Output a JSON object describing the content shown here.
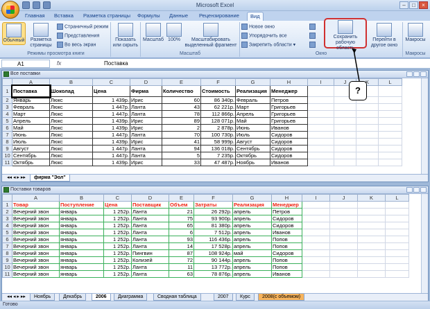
{
  "app_title": "Microsoft Excel",
  "tabs": [
    "Главная",
    "Вставка",
    "Разметка страницы",
    "Формулы",
    "Данные",
    "Рецензирование",
    "Вид"
  ],
  "active_tab": "Вид",
  "ribbon": {
    "normal": "Обычный",
    "page_layout": "Разметка страницы",
    "page_mode": "Страничный режим",
    "views": "Представления",
    "fullscreen": "Во весь экран",
    "group_views": "Режимы просмотра книги",
    "show_hide": "Показать или скрыть",
    "zoom": "Масштаб",
    "zoom100": "100%",
    "zoom_sel": "Масштабировать выделенный фрагмент",
    "group_zoom": "Масштаб",
    "new_window": "Новое окно",
    "arrange_all": "Упорядочить все",
    "freeze": "Закрепить области",
    "save_ws": "Сохранить рабочую область",
    "switch": "Перейти в другое окно",
    "group_window": "Окно",
    "macros": "Макросы",
    "group_macros": "Макросы"
  },
  "formula": {
    "cell": "A1",
    "fx": "fx",
    "value": "Поставка"
  },
  "callout": "?",
  "cols": [
    "A",
    "B",
    "C",
    "D",
    "E",
    "F",
    "G",
    "H",
    "I",
    "J",
    "K",
    "L"
  ],
  "win1": {
    "title": "Все поставки",
    "headers": [
      "Поставка",
      "Шоколад",
      "Цена",
      "Фирма",
      "Количество",
      "Стоимость",
      "Реализация",
      "Менеджер"
    ],
    "rows": [
      [
        "2",
        "Январь",
        "Люкс",
        "1 439р.",
        "Ирис",
        "60",
        "86 340р.",
        "Февраль",
        "Петров"
      ],
      [
        "3",
        "Февраль",
        "Люкс",
        "1 447р.",
        "Ланта",
        "43",
        "62 221р.",
        "Март",
        "Григорьев"
      ],
      [
        "4",
        "Март",
        "Люкс",
        "1 447р.",
        "Ланта",
        "78",
        "112 866р.",
        "Апрель",
        "Григорьев"
      ],
      [
        "5",
        "Апрель",
        "Люкс",
        "1 439р.",
        "Ирис",
        "89",
        "128 071р.",
        "Май",
        "Григорьев"
      ],
      [
        "6",
        "Май",
        "Люкс",
        "1 439р.",
        "Ирис",
        "2",
        "2 878р.",
        "Июнь",
        "Иванов"
      ],
      [
        "7",
        "Июнь",
        "Люкс",
        "1 447р.",
        "Ланта",
        "70",
        "100 730р.",
        "Июль",
        "Сидоров"
      ],
      [
        "8",
        "Июль",
        "Люкс",
        "1 439р.",
        "Ирис",
        "41",
        "58 999р.",
        "Август",
        "Сидоров"
      ],
      [
        "9",
        "Август",
        "Люкс",
        "1 447р.",
        "Ланта",
        "94",
        "136 018р.",
        "Сентябрь",
        "Сидоров"
      ],
      [
        "10",
        "Сентябрь",
        "Люкс",
        "1 447р.",
        "Ланта",
        "5",
        "7 235р.",
        "Октябрь",
        "Сидоров"
      ],
      [
        "11",
        "Октябрь",
        "Люкс",
        "1 439р.",
        "Ирис",
        "33",
        "47 487р.",
        "Ноябрь",
        "Иванов"
      ]
    ],
    "sheet": "фирма \"Эол\""
  },
  "win2": {
    "title": "Поставки товаров",
    "headers": [
      "Товар",
      "Поступление",
      "Цена",
      "Поставщик",
      "Объем",
      "Затраты",
      "Реализация",
      "Менеджер"
    ],
    "rows": [
      [
        "2",
        "Вечерний звон",
        "январь",
        "1 252р.",
        "Ланта",
        "21",
        "26 292р.",
        "апрель",
        "Петров"
      ],
      [
        "3",
        "Вечерний звон",
        "январь",
        "1 252р.",
        "Ланта",
        "75",
        "93 900р.",
        "апрель",
        "Сидоров"
      ],
      [
        "4",
        "Вечерний звон",
        "январь",
        "1 252р.",
        "Ланта",
        "65",
        "81 380р.",
        "апрель",
        "Сидоров"
      ],
      [
        "5",
        "Вечерний звон",
        "январь",
        "1 252р.",
        "Ланта",
        "6",
        "7 512р.",
        "апрель",
        "Иванов"
      ],
      [
        "6",
        "Вечерний звон",
        "январь",
        "1 252р.",
        "Ланта",
        "93",
        "116 436р.",
        "апрель",
        "Попов"
      ],
      [
        "7",
        "Вечерний звон",
        "январь",
        "1 252р.",
        "Ланта",
        "14",
        "17 528р.",
        "апрель",
        "Попов"
      ],
      [
        "8",
        "Вечерний звон",
        "январь",
        "1 252р.",
        "Пингвин",
        "87",
        "108 924р.",
        "май",
        "Сидоров"
      ],
      [
        "9",
        "Вечерний звон",
        "январь",
        "1 252р.",
        "Колизей",
        "72",
        "90 144р.",
        "апрель",
        "Попов"
      ],
      [
        "10",
        "Вечерний звон",
        "январь",
        "1 252р.",
        "Ланта",
        "11",
        "13 772р.",
        "апрель",
        "Попов"
      ],
      [
        "11",
        "Вечерний звон",
        "январь",
        "1 252р.",
        "Ланта",
        "63",
        "78 876р.",
        "апрель",
        "Иванов"
      ]
    ],
    "sheets": [
      "Ноябрь",
      "Декабрь",
      "2006",
      "Диаграмма",
      "Сводная таблица",
      "2007",
      "Курс",
      "2008(с объемом)"
    ]
  },
  "status": "Готово"
}
